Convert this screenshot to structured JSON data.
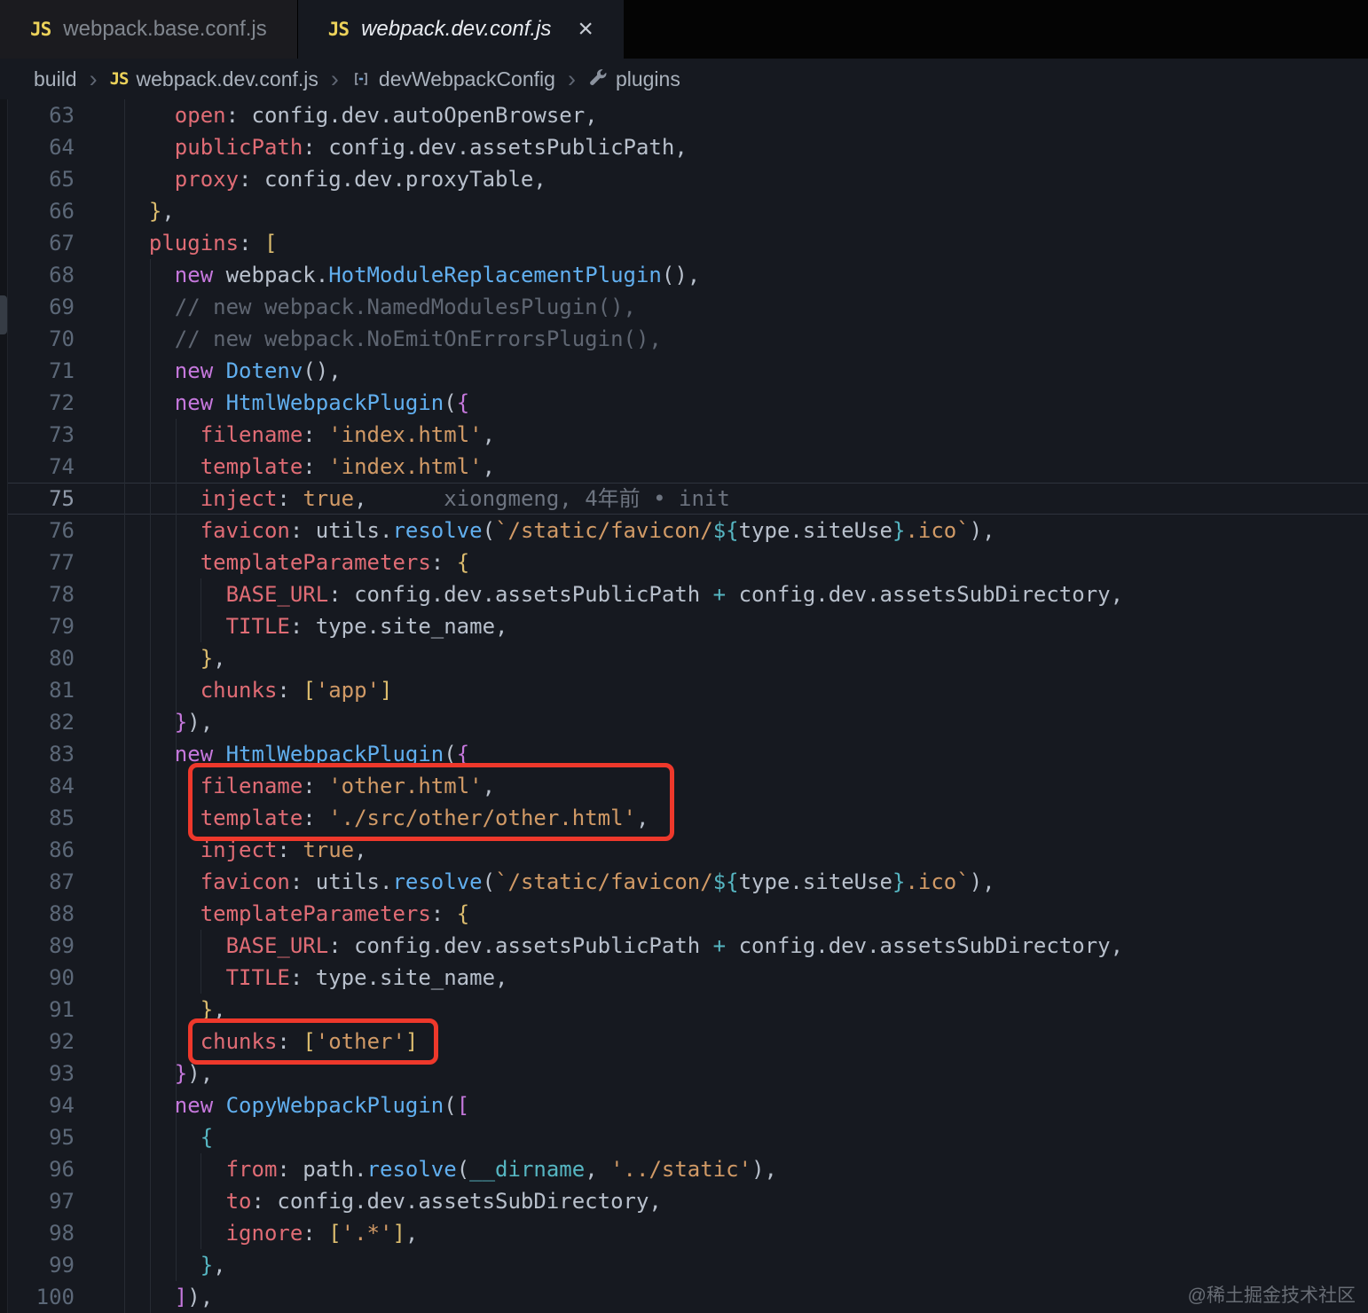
{
  "tab_bar": {
    "tabs": [
      {
        "label": "webpack.base.conf.js",
        "icon": "JS",
        "state": "inactive"
      },
      {
        "label": "webpack.dev.conf.js",
        "icon": "JS",
        "state": "active",
        "close_glyph": "×"
      }
    ]
  },
  "breadcrumb": {
    "separator": "›",
    "items": [
      {
        "label": "build",
        "icon": null
      },
      {
        "label": "webpack.dev.conf.js",
        "icon": "js-file-icon"
      },
      {
        "label": "devWebpackConfig",
        "icon": "symbol-variable-icon"
      },
      {
        "label": "plugins",
        "icon": "wrench-icon"
      }
    ]
  },
  "editor": {
    "language": "javascript",
    "current_line": 75,
    "git_blame": "xiongmeng, 4年前 • init",
    "lines": [
      {
        "n": 63,
        "segs": [
          {
            "t": "    ",
            "c": "fg"
          },
          {
            "t": "open",
            "c": "prop"
          },
          {
            "t": ": config.dev.autoOpenBrowser,",
            "c": "fg"
          }
        ]
      },
      {
        "n": 64,
        "segs": [
          {
            "t": "    ",
            "c": "fg"
          },
          {
            "t": "publicPath",
            "c": "prop"
          },
          {
            "t": ": config.dev.assetsPublicPath,",
            "c": "fg"
          }
        ]
      },
      {
        "n": 65,
        "segs": [
          {
            "t": "    ",
            "c": "fg"
          },
          {
            "t": "proxy",
            "c": "prop"
          },
          {
            "t": ": config.dev.proxyTable,",
            "c": "fg"
          }
        ]
      },
      {
        "n": 66,
        "segs": [
          {
            "t": "  ",
            "c": "fg"
          },
          {
            "t": "}",
            "c": "b1"
          },
          {
            "t": ",",
            "c": "fg"
          }
        ]
      },
      {
        "n": 67,
        "segs": [
          {
            "t": "  ",
            "c": "fg"
          },
          {
            "t": "plugins",
            "c": "prop"
          },
          {
            "t": ": ",
            "c": "fg"
          },
          {
            "t": "[",
            "c": "b1"
          }
        ]
      },
      {
        "n": 68,
        "segs": [
          {
            "t": "    ",
            "c": "fg"
          },
          {
            "t": "new",
            "c": "kw"
          },
          {
            "t": " webpack.",
            "c": "fg"
          },
          {
            "t": "HotModuleReplacementPlugin",
            "c": "fn"
          },
          {
            "t": "(),",
            "c": "fg"
          }
        ]
      },
      {
        "n": 69,
        "segs": [
          {
            "t": "    ",
            "c": "fg"
          },
          {
            "t": "// new webpack.NamedModulesPlugin(),",
            "c": "cm"
          }
        ]
      },
      {
        "n": 70,
        "segs": [
          {
            "t": "    ",
            "c": "fg"
          },
          {
            "t": "// new webpack.NoEmitOnErrorsPlugin(),",
            "c": "cm"
          }
        ]
      },
      {
        "n": 71,
        "segs": [
          {
            "t": "    ",
            "c": "fg"
          },
          {
            "t": "new",
            "c": "kw"
          },
          {
            "t": " ",
            "c": "fg"
          },
          {
            "t": "Dotenv",
            "c": "fn"
          },
          {
            "t": "(),",
            "c": "fg"
          }
        ]
      },
      {
        "n": 72,
        "segs": [
          {
            "t": "    ",
            "c": "fg"
          },
          {
            "t": "new",
            "c": "kw"
          },
          {
            "t": " ",
            "c": "fg"
          },
          {
            "t": "HtmlWebpackPlugin",
            "c": "fn"
          },
          {
            "t": "(",
            "c": "fg"
          },
          {
            "t": "{",
            "c": "b2"
          }
        ]
      },
      {
        "n": 73,
        "segs": [
          {
            "t": "      ",
            "c": "fg"
          },
          {
            "t": "filename",
            "c": "prop"
          },
          {
            "t": ": ",
            "c": "fg"
          },
          {
            "t": "'index.html'",
            "c": "str"
          },
          {
            "t": ",",
            "c": "fg"
          }
        ]
      },
      {
        "n": 74,
        "segs": [
          {
            "t": "      ",
            "c": "fg"
          },
          {
            "t": "template",
            "c": "prop"
          },
          {
            "t": ": ",
            "c": "fg"
          },
          {
            "t": "'index.html'",
            "c": "str"
          },
          {
            "t": ",",
            "c": "fg"
          }
        ]
      },
      {
        "n": 75,
        "segs": [
          {
            "t": "      ",
            "c": "fg"
          },
          {
            "t": "inject",
            "c": "prop"
          },
          {
            "t": ": ",
            "c": "fg"
          },
          {
            "t": "true",
            "c": "bool"
          },
          {
            "t": ",",
            "c": "fg"
          },
          {
            "t": "      xiongmeng, 4年前 • init",
            "c": "blame"
          }
        ]
      },
      {
        "n": 76,
        "segs": [
          {
            "t": "      ",
            "c": "fg"
          },
          {
            "t": "favicon",
            "c": "prop"
          },
          {
            "t": ": utils.",
            "c": "fg"
          },
          {
            "t": "resolve",
            "c": "fn"
          },
          {
            "t": "(",
            "c": "fg"
          },
          {
            "t": "`/static/favicon/",
            "c": "str"
          },
          {
            "t": "${",
            "c": "op"
          },
          {
            "t": "type.siteUse",
            "c": "fg"
          },
          {
            "t": "}",
            "c": "op"
          },
          {
            "t": ".ico`",
            "c": "str"
          },
          {
            "t": "),",
            "c": "fg"
          }
        ]
      },
      {
        "n": 77,
        "segs": [
          {
            "t": "      ",
            "c": "fg"
          },
          {
            "t": "templateParameters",
            "c": "prop"
          },
          {
            "t": ": ",
            "c": "fg"
          },
          {
            "t": "{",
            "c": "b1"
          }
        ]
      },
      {
        "n": 78,
        "segs": [
          {
            "t": "        ",
            "c": "fg"
          },
          {
            "t": "BASE_URL",
            "c": "prop"
          },
          {
            "t": ": config.dev.assetsPublicPath ",
            "c": "fg"
          },
          {
            "t": "+",
            "c": "op"
          },
          {
            "t": " config.dev.assetsSubDirectory,",
            "c": "fg"
          }
        ]
      },
      {
        "n": 79,
        "segs": [
          {
            "t": "        ",
            "c": "fg"
          },
          {
            "t": "TITLE",
            "c": "prop"
          },
          {
            "t": ": type.site_name,",
            "c": "fg"
          }
        ]
      },
      {
        "n": 80,
        "segs": [
          {
            "t": "      ",
            "c": "fg"
          },
          {
            "t": "}",
            "c": "b1"
          },
          {
            "t": ",",
            "c": "fg"
          }
        ]
      },
      {
        "n": 81,
        "segs": [
          {
            "t": "      ",
            "c": "fg"
          },
          {
            "t": "chunks",
            "c": "prop"
          },
          {
            "t": ": ",
            "c": "fg"
          },
          {
            "t": "[",
            "c": "b1"
          },
          {
            "t": "'app'",
            "c": "str"
          },
          {
            "t": "]",
            "c": "b1"
          }
        ]
      },
      {
        "n": 82,
        "segs": [
          {
            "t": "    ",
            "c": "fg"
          },
          {
            "t": "}",
            "c": "b2"
          },
          {
            "t": "),",
            "c": "fg"
          }
        ]
      },
      {
        "n": 83,
        "segs": [
          {
            "t": "    ",
            "c": "fg"
          },
          {
            "t": "new",
            "c": "kw"
          },
          {
            "t": " ",
            "c": "fg"
          },
          {
            "t": "HtmlWebpackPlugin",
            "c": "fn"
          },
          {
            "t": "(",
            "c": "fg"
          },
          {
            "t": "{",
            "c": "b2"
          }
        ]
      },
      {
        "n": 84,
        "segs": [
          {
            "t": "      ",
            "c": "fg"
          },
          {
            "t": "filename",
            "c": "prop"
          },
          {
            "t": ": ",
            "c": "fg"
          },
          {
            "t": "'other.html'",
            "c": "str"
          },
          {
            "t": ",",
            "c": "fg"
          }
        ]
      },
      {
        "n": 85,
        "segs": [
          {
            "t": "      ",
            "c": "fg"
          },
          {
            "t": "template",
            "c": "prop"
          },
          {
            "t": ": ",
            "c": "fg"
          },
          {
            "t": "'./src/other/other.html'",
            "c": "str"
          },
          {
            "t": ",",
            "c": "fg"
          }
        ]
      },
      {
        "n": 86,
        "segs": [
          {
            "t": "      ",
            "c": "fg"
          },
          {
            "t": "inject",
            "c": "prop"
          },
          {
            "t": ": ",
            "c": "fg"
          },
          {
            "t": "true",
            "c": "bool"
          },
          {
            "t": ",",
            "c": "fg"
          }
        ]
      },
      {
        "n": 87,
        "segs": [
          {
            "t": "      ",
            "c": "fg"
          },
          {
            "t": "favicon",
            "c": "prop"
          },
          {
            "t": ": utils.",
            "c": "fg"
          },
          {
            "t": "resolve",
            "c": "fn"
          },
          {
            "t": "(",
            "c": "fg"
          },
          {
            "t": "`/static/favicon/",
            "c": "str"
          },
          {
            "t": "${",
            "c": "op"
          },
          {
            "t": "type.siteUse",
            "c": "fg"
          },
          {
            "t": "}",
            "c": "op"
          },
          {
            "t": ".ico`",
            "c": "str"
          },
          {
            "t": "),",
            "c": "fg"
          }
        ]
      },
      {
        "n": 88,
        "segs": [
          {
            "t": "      ",
            "c": "fg"
          },
          {
            "t": "templateParameters",
            "c": "prop"
          },
          {
            "t": ": ",
            "c": "fg"
          },
          {
            "t": "{",
            "c": "b1"
          }
        ]
      },
      {
        "n": 89,
        "segs": [
          {
            "t": "        ",
            "c": "fg"
          },
          {
            "t": "BASE_URL",
            "c": "prop"
          },
          {
            "t": ": config.dev.assetsPublicPath ",
            "c": "fg"
          },
          {
            "t": "+",
            "c": "op"
          },
          {
            "t": " config.dev.assetsSubDirectory,",
            "c": "fg"
          }
        ]
      },
      {
        "n": 90,
        "segs": [
          {
            "t": "        ",
            "c": "fg"
          },
          {
            "t": "TITLE",
            "c": "prop"
          },
          {
            "t": ": type.site_name,",
            "c": "fg"
          }
        ]
      },
      {
        "n": 91,
        "segs": [
          {
            "t": "      ",
            "c": "fg"
          },
          {
            "t": "}",
            "c": "b1"
          },
          {
            "t": ",",
            "c": "fg"
          }
        ]
      },
      {
        "n": 92,
        "segs": [
          {
            "t": "      ",
            "c": "fg"
          },
          {
            "t": "chunks",
            "c": "prop"
          },
          {
            "t": ": ",
            "c": "fg"
          },
          {
            "t": "[",
            "c": "b1"
          },
          {
            "t": "'other'",
            "c": "str"
          },
          {
            "t": "]",
            "c": "b1"
          }
        ]
      },
      {
        "n": 93,
        "segs": [
          {
            "t": "    ",
            "c": "fg"
          },
          {
            "t": "}",
            "c": "b2"
          },
          {
            "t": "),",
            "c": "fg"
          }
        ]
      },
      {
        "n": 94,
        "segs": [
          {
            "t": "    ",
            "c": "fg"
          },
          {
            "t": "new",
            "c": "kw"
          },
          {
            "t": " ",
            "c": "fg"
          },
          {
            "t": "CopyWebpackPlugin",
            "c": "fn"
          },
          {
            "t": "(",
            "c": "fg"
          },
          {
            "t": "[",
            "c": "b2"
          }
        ]
      },
      {
        "n": 95,
        "segs": [
          {
            "t": "      ",
            "c": "fg"
          },
          {
            "t": "{",
            "c": "b3"
          }
        ]
      },
      {
        "n": 96,
        "segs": [
          {
            "t": "        ",
            "c": "fg"
          },
          {
            "t": "from",
            "c": "prop"
          },
          {
            "t": ": path.",
            "c": "fg"
          },
          {
            "t": "resolve",
            "c": "fn"
          },
          {
            "t": "(",
            "c": "fg"
          },
          {
            "t": "__dirname",
            "c": "op"
          },
          {
            "t": ", ",
            "c": "fg"
          },
          {
            "t": "'../static'",
            "c": "str"
          },
          {
            "t": "),",
            "c": "fg"
          }
        ]
      },
      {
        "n": 97,
        "segs": [
          {
            "t": "        ",
            "c": "fg"
          },
          {
            "t": "to",
            "c": "prop"
          },
          {
            "t": ": config.dev.assetsSubDirectory,",
            "c": "fg"
          }
        ]
      },
      {
        "n": 98,
        "segs": [
          {
            "t": "        ",
            "c": "fg"
          },
          {
            "t": "ignore",
            "c": "prop"
          },
          {
            "t": ": ",
            "c": "fg"
          },
          {
            "t": "[",
            "c": "b1"
          },
          {
            "t": "'.*'",
            "c": "str"
          },
          {
            "t": "]",
            "c": "b1"
          },
          {
            "t": ",",
            "c": "fg"
          }
        ]
      },
      {
        "n": 99,
        "segs": [
          {
            "t": "      ",
            "c": "fg"
          },
          {
            "t": "}",
            "c": "b3"
          },
          {
            "t": ",",
            "c": "fg"
          }
        ]
      },
      {
        "n": 100,
        "segs": [
          {
            "t": "    ",
            "c": "fg"
          },
          {
            "t": "]",
            "c": "b2"
          },
          {
            "t": "),",
            "c": "fg"
          }
        ]
      }
    ]
  },
  "annotations": {
    "color": "#ee382b",
    "boxes": [
      {
        "around_lines": "84-85",
        "content": "filename: 'other.html', template: './src/other/other.html',"
      },
      {
        "around_lines": "92",
        "content": "chunks: ['other']"
      }
    ]
  },
  "watermark": "@稀土掘金技术社区"
}
